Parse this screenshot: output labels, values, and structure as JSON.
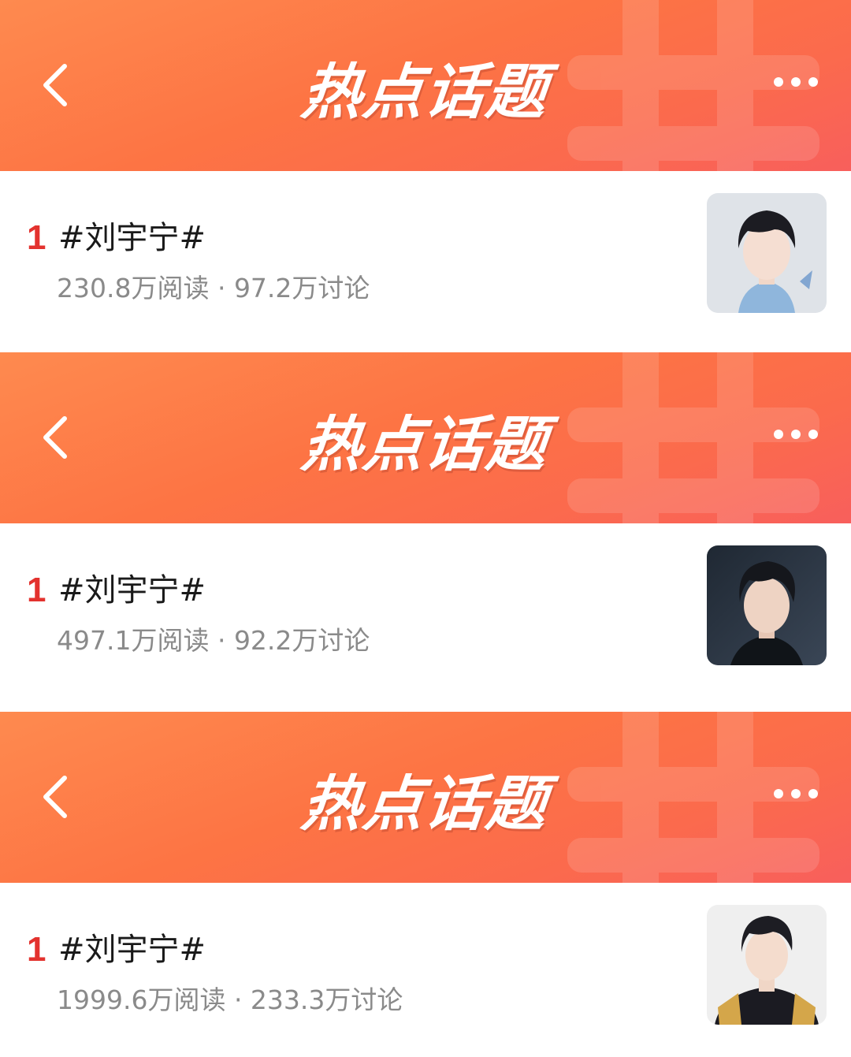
{
  "panels": [
    {
      "header": {
        "title": "热点话题"
      },
      "item": {
        "rank": "1",
        "topic": "#刘宇宁#",
        "stats": "230.8万阅读 · 97.2万讨论"
      }
    },
    {
      "header": {
        "title": "热点话题"
      },
      "item": {
        "rank": "1",
        "topic": "#刘宇宁#",
        "stats": "497.1万阅读 · 92.2万讨论"
      }
    },
    {
      "header": {
        "title": "热点话题"
      },
      "item": {
        "rank": "1",
        "topic": "#刘宇宁#",
        "stats": "1999.6万阅读 · 233.3万讨论"
      }
    }
  ],
  "icons": {
    "back": "chevron-left-icon",
    "more": "more-dots-icon",
    "background": "hashtag-watermark"
  },
  "colors": {
    "header_start": "#fe8a4f",
    "header_end": "#f85f5c",
    "rank": "#e3322e",
    "stats": "#8a8a8a"
  }
}
